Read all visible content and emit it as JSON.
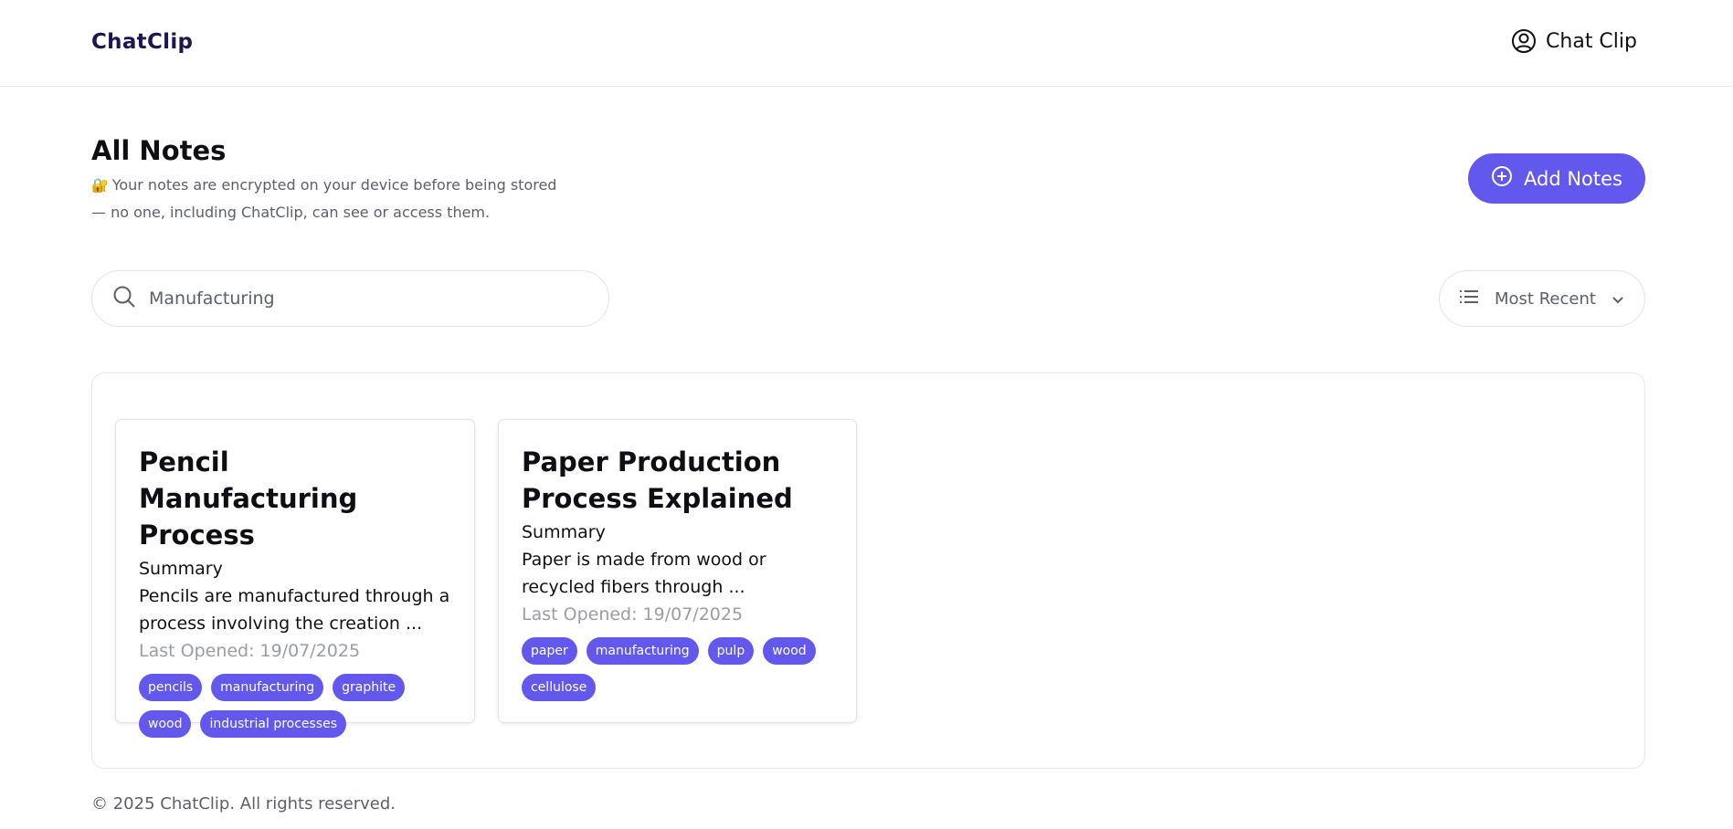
{
  "header": {
    "brand": "ChatClip",
    "user_label": "Chat Clip",
    "user_icon": "user-circle-icon"
  },
  "page": {
    "title": "All Notes",
    "notice_icon": "lock-icon",
    "notice": "Your notes are encrypted on your device before being stored — no one, including ChatClip, can see or access them.",
    "add_button_label": "Add Notes",
    "add_button_icon": "plus-circle-icon"
  },
  "search": {
    "value": "Manufacturing",
    "icon": "search-icon"
  },
  "sort": {
    "selected": "Most Recent",
    "icon": "list-icon"
  },
  "notes": [
    {
      "title": "Pencil Manufacturing Process",
      "section": "Summary",
      "excerpt": "Pencils are manufactured through a process involving the creation ...",
      "last_opened": "Last Opened: 19/07/2025",
      "tags": [
        "pencils",
        "manufacturing",
        "graphite",
        "wood",
        "industrial processes"
      ]
    },
    {
      "title": "Paper Production Process Explained",
      "section": "Summary",
      "excerpt": "Paper is made from wood or recycled fibers through ...",
      "last_opened": "Last Opened: 19/07/2025",
      "tags": [
        "paper",
        "manufacturing",
        "pulp",
        "wood",
        "cellulose"
      ]
    }
  ],
  "footer": {
    "copyright": "© 2025 ChatClip. All rights reserved."
  },
  "colors": {
    "accent": "#6358ee",
    "brand": "#1e1650",
    "muted_text": "#5b5f6b",
    "date_text": "#9a9ca6",
    "border": "#e2e3e8"
  }
}
